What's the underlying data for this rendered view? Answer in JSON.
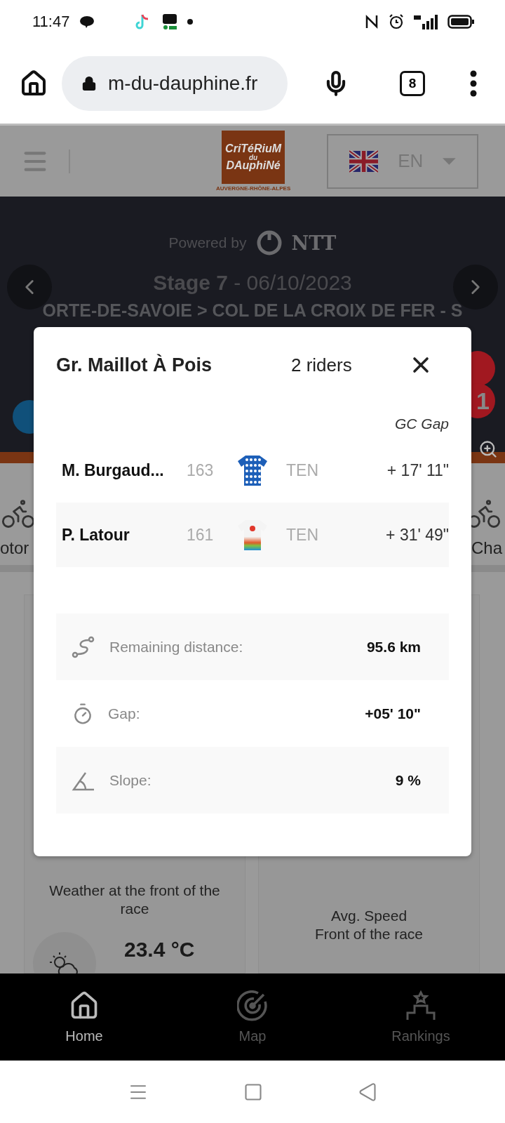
{
  "status_bar": {
    "time": "11:47"
  },
  "browser": {
    "url": "m-du-dauphine.fr",
    "tab_count": "8"
  },
  "site_header": {
    "logo_lines": [
      "CriTéRiuM",
      "du",
      "DAuphiNé"
    ],
    "logo_region": "AUVERGNE-RHÔNE-ALPES",
    "language": "EN"
  },
  "hero": {
    "powered_by": "Powered by",
    "sponsor": "NTT",
    "stage": "Stage 7",
    "date": "- 06/10/2023",
    "route": "ORTE-DE-SAVOIE > COL DE LA CROIX DE FER - S",
    "badge": "1"
  },
  "carousel": [
    {
      "label": "otor"
    },
    {
      "label": "Cha"
    }
  ],
  "cards": [
    {
      "kind": "weather",
      "title": "Weather at the front of the race",
      "value": "23.4 °C"
    },
    {
      "kind": "speed",
      "title": "Avg. Speed",
      "subtitle": "Front of the race"
    }
  ],
  "modal": {
    "title": "Gr. Maillot À Pois",
    "count": "2 riders",
    "column_header": "GC Gap",
    "riders": [
      {
        "name": "M. Burgaud...",
        "number": "163",
        "kind": "polka",
        "team": "TEN",
        "gap": "+ 17' 11\""
      },
      {
        "name": "P. Latour",
        "number": "161",
        "kind": "team",
        "team": "TEN",
        "gap": "+ 31' 49\""
      }
    ],
    "stats": [
      {
        "kind": "distance",
        "label": "Remaining distance:",
        "value": "95.6 km"
      },
      {
        "kind": "gap",
        "label": "Gap:",
        "value": "+05' 10\""
      },
      {
        "kind": "slope",
        "label": "Slope:",
        "value": "9 %"
      }
    ]
  },
  "bottom_nav": [
    {
      "kind": "home",
      "label": "Home",
      "selected": true
    },
    {
      "kind": "map",
      "label": "Map",
      "selected": false
    },
    {
      "kind": "rankings",
      "label": "Rankings",
      "selected": false
    }
  ]
}
